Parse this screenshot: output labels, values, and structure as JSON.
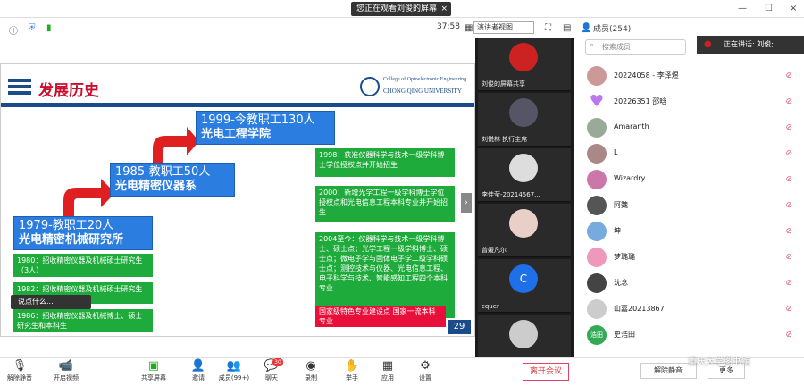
{
  "top": {
    "viewing_text": "您正在观看刘俊的屏幕",
    "close": "×",
    "timer": "37:58",
    "view_mode": "演讲者视图",
    "window_controls": [
      "—",
      "☐",
      "×"
    ]
  },
  "slide": {
    "title": "发展历史",
    "uni_en_1": "College of Optoelectronic Engineering",
    "uni_en_2": "CHONG QING UNIVERSITY",
    "stages": [
      {
        "year": "1979-教职工20人",
        "name": "光电精密机械研究所"
      },
      {
        "year": "1985-教职工50人",
        "name": "光电精密仪器系"
      },
      {
        "year": "1999-今教职工130人",
        "name": "光电工程学院"
      }
    ],
    "left_items": [
      "1980：招收精密仪器及机械硕士研究生（3人）",
      "1982：招收精密仪器及机械硕士研究生（30人）",
      "1986：招收精密仪器及机械博士、硕士研究生和本科生"
    ],
    "right_items": [
      "1998：获准仪器科学与技术一级学科博士学位授权点并开始招生",
      "2000：新增光学工程一级学科博士学位授权点和光电信息工程本科专业并开始招生",
      "2004至今：仪器科学与技术一级学科博士、硕士点；光学工程一级学科博士、硕士点；微电子学与固体电子学二级学科硕士点；测控技术与仪器、光电信息工程、电子科学与技术、智能感知工程四个本科专业"
    ],
    "right_red": "国家级特色专业建设点 国家一流本科专业",
    "page": "29",
    "chat_hint": "说点什么...",
    "collapse": "›"
  },
  "videos": [
    {
      "name": "刘俊的屏幕共享"
    },
    {
      "name": "刘悦林 执行主席"
    },
    {
      "name": "李佳莹-20214567..."
    },
    {
      "name": "曾媛凡尔"
    },
    {
      "name": "cquer",
      "initial": "C"
    },
    {
      "name": ""
    }
  ],
  "panel": {
    "title": "成员(254)",
    "search_placeholder": "搜索成员",
    "speaking": "正在讲话: 刘俊;",
    "members": [
      {
        "name": "20224058 - 李泽煜",
        "color": "#c99"
      },
      {
        "name": "20226351 邵晗",
        "color": "#b7e"
      },
      {
        "name": "Amaranth",
        "color": "#9a9"
      },
      {
        "name": "L",
        "color": "#a88"
      },
      {
        "name": "Wizardry",
        "color": "#c7a"
      },
      {
        "name": "阿魏",
        "color": "#555"
      },
      {
        "name": "坤",
        "color": "#7ad"
      },
      {
        "name": "梦璐璐",
        "color": "#e9b"
      },
      {
        "name": "沈念",
        "color": "#444"
      },
      {
        "name": "山嘉20213867",
        "color": "#ccc"
      },
      {
        "name": "史浩田",
        "color": "#3a5",
        "initial": "浩田"
      }
    ]
  },
  "bottom": {
    "buttons": [
      "解除静音",
      "开启视频",
      "共享屏幕",
      "邀请",
      "成员(99+)",
      "聊天",
      "录制",
      "举手",
      "应用",
      "设置"
    ],
    "chat_badge": "30",
    "leave": "离开会议",
    "unmute_all": "解除静音",
    "more": "更多",
    "watermark": "重庆大学图书馆"
  }
}
